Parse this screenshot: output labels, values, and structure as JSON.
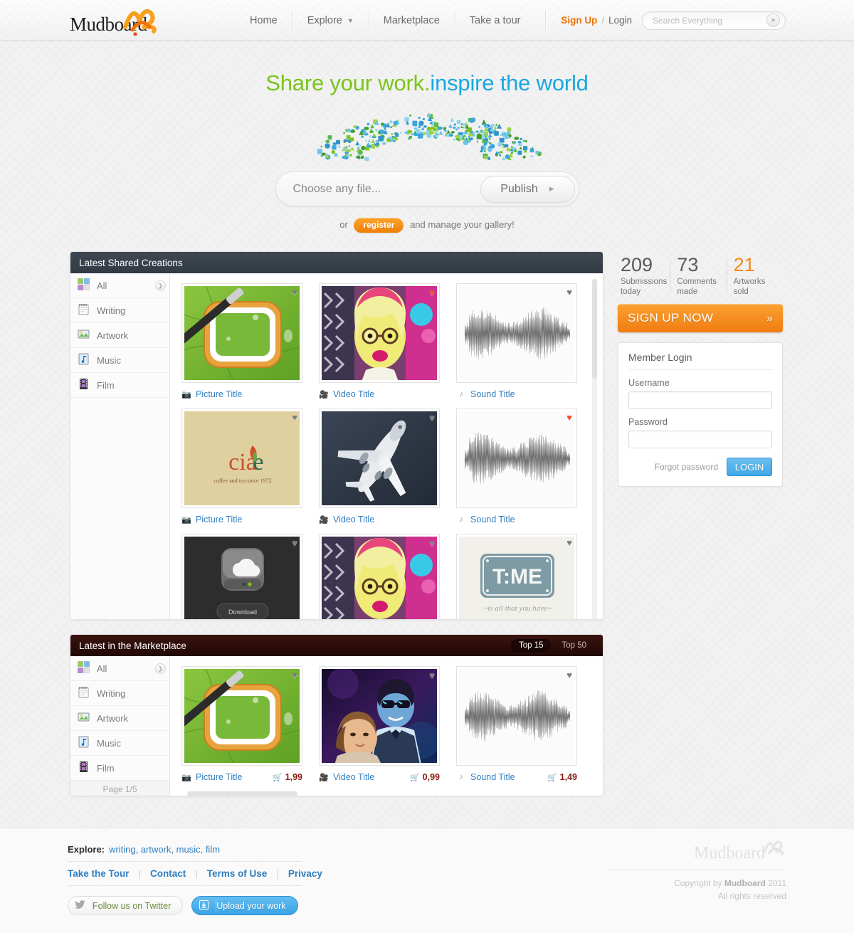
{
  "header": {
    "logo_text": "Mudboard",
    "nav": [
      {
        "label": "Home",
        "caret": false
      },
      {
        "label": "Explore",
        "caret": true
      },
      {
        "label": "Marketplace",
        "caret": false
      },
      {
        "label": "Take a tour",
        "caret": false
      }
    ],
    "signup_label": "Sign Up",
    "auth_separator": "/",
    "login_label": "Login",
    "search_placeholder": "Search Everything",
    "search_value": "",
    "search_icon": "search-go-icon"
  },
  "hero": {
    "headline_green": "Share your work.",
    "headline_blue": "inspire the world",
    "file_placeholder": "Choose any file...",
    "publish_label": "Publish",
    "or_prefix": "or",
    "register_label": "register",
    "or_suffix": "and manage your gallery!"
  },
  "creations": {
    "title": "Latest Shared Creations",
    "categories": [
      {
        "label": "All",
        "icon": "all-media-icon"
      },
      {
        "label": "Writing",
        "icon": "notepad-icon"
      },
      {
        "label": "Artwork",
        "icon": "picture-icon"
      },
      {
        "label": "Music",
        "icon": "music-note-icon"
      },
      {
        "label": "Film",
        "icon": "film-strip-icon"
      }
    ],
    "items": [
      {
        "title": "Picture Title",
        "type": "picture",
        "icon": "camera-icon",
        "liked": false,
        "art": "leaf-icon"
      },
      {
        "title": "Video Title",
        "type": "video",
        "icon": "video-camera-icon",
        "liked": true,
        "art": "portrait-blonde"
      },
      {
        "title": "Sound Title",
        "type": "sound",
        "icon": "music-note-icon",
        "liked": false,
        "art": "waveform"
      },
      {
        "title": "Picture Title",
        "type": "picture",
        "icon": "camera-icon",
        "liked": false,
        "art": "ciaoe-logo"
      },
      {
        "title": "Video Title",
        "type": "video",
        "icon": "video-camera-icon",
        "liked": false,
        "art": "airplane"
      },
      {
        "title": "Sound Title",
        "type": "sound",
        "icon": "music-note-icon",
        "liked": true,
        "art": "waveform"
      },
      {
        "title": "",
        "type": "picture",
        "icon": "camera-icon",
        "liked": false,
        "art": "cloud-app-icon"
      },
      {
        "title": "",
        "type": "video",
        "icon": "video-camera-icon",
        "liked": false,
        "art": "portrait-blonde"
      },
      {
        "title": "",
        "type": "picture",
        "icon": "camera-icon",
        "liked": false,
        "art": "time-poster"
      }
    ],
    "art_labels": {
      "ciaoe_name": "ciaOe",
      "ciaoe_tag": "coffee and tea since 1972",
      "download_label": "Download",
      "time_label": "T:ME",
      "time_sub": "~is all that you have~"
    }
  },
  "marketplace": {
    "title": "Latest in the Marketplace",
    "tabs": [
      {
        "label": "Top 15",
        "active": true
      },
      {
        "label": "Top 50",
        "active": false
      }
    ],
    "categories": [
      {
        "label": "All",
        "icon": "all-media-icon"
      },
      {
        "label": "Writing",
        "icon": "notepad-icon"
      },
      {
        "label": "Artwork",
        "icon": "picture-icon"
      },
      {
        "label": "Music",
        "icon": "music-note-icon"
      },
      {
        "label": "Film",
        "icon": "film-strip-icon"
      }
    ],
    "page_label": "Page 1/5",
    "items": [
      {
        "title": "Picture Title",
        "type": "picture",
        "icon": "camera-icon",
        "price": "1,99",
        "liked": false,
        "art": "leaf-icon"
      },
      {
        "title": "Video Title",
        "type": "video",
        "icon": "video-camera-icon",
        "price": "0,99",
        "liked": false,
        "art": "night-couple"
      },
      {
        "title": "Sound Title",
        "type": "sound",
        "icon": "music-note-icon",
        "price": "1,49",
        "liked": false,
        "art": "waveform"
      }
    ]
  },
  "rail": {
    "stats": [
      {
        "number": "209",
        "label": "Submissions\ntoday",
        "accent": false
      },
      {
        "number": "73",
        "label": "Comments\nmade",
        "accent": false
      },
      {
        "number": "21",
        "label": "Artworks\nsold",
        "accent": true
      }
    ],
    "signup_cta": "SIGN UP NOW",
    "signup_chev": "»",
    "login": {
      "title": "Member Login",
      "username_label": "Username",
      "username_value": "",
      "password_label": "Password",
      "password_value": "",
      "forgot_label": "Forgot password",
      "button_label": "LOGIN"
    }
  },
  "footer": {
    "explore_label": "Explore:",
    "explore_links": "writing, artwork, music, film",
    "links": [
      "Take the Tour",
      "Contact",
      "Terms of Use",
      "Privacy"
    ],
    "twitter_label": "Follow us on Twitter",
    "upload_label": "Upload your work",
    "logo_text": "Mudboard",
    "copyright_prefix": "Copyright by",
    "copyright_brand": "Mudboard",
    "copyright_year": "2011",
    "rights": "All rights reserved"
  },
  "colors": {
    "orange": "#ee7203",
    "green": "#7ac518",
    "blue": "#17a8e0",
    "link": "#2f7ec0",
    "price": "#8b1a10"
  }
}
